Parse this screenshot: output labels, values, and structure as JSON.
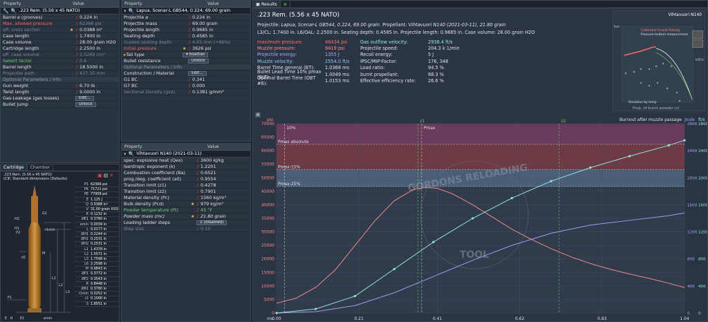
{
  "p1": {
    "col_property": "Property",
    "col_value": "Value",
    "title": ".223 Rem. (5.56 x 45 NATO)",
    "rows": [
      {
        "k": "Barrel ⌀ (grooves)",
        "v": "0.224 in",
        "kc": "",
        "vc": ""
      },
      {
        "k": "Max. allowed pressure",
        "v": "62366 psi",
        "kc": "red",
        "vc": "grey"
      },
      {
        "k": "eff. cross section",
        "v": "0.0388 in²",
        "kc": "grey",
        "vc": "",
        "star": true
      },
      {
        "k": "Case length",
        "v": "1.7400 in",
        "kc": "",
        "vc": ""
      },
      {
        "k": "Case volume",
        "v": "28.00 grain H2O",
        "kc": "",
        "vc": ""
      },
      {
        "k": "Cartridge length",
        "v": "2.2500 in",
        "kc": "",
        "vc": ""
      },
      {
        "k": "eff. case volume",
        "v": "1.5269 cm³",
        "kc": "grey",
        "vc": "grey"
      },
      {
        "k": "Sebert factor",
        "v": "0.6",
        "kc": "green",
        "vc": "grey"
      },
      {
        "k": "Barrel length",
        "v": "18.5000 in",
        "kc": "",
        "vc": ""
      },
      {
        "k": "Projectile path",
        "v": "437.35 mm",
        "kc": "grey",
        "vc": "grey"
      }
    ],
    "section": "Optional Parameters / Info",
    "rows2": [
      {
        "k": "Gun weight",
        "v": "6.70 lb"
      },
      {
        "k": "Twist length",
        "v": "9.0000 in"
      },
      {
        "k": "Gas-Leakage (gas losses)",
        "btn": "Edit..."
      },
      {
        "k": "Bullet Jump",
        "btn": "Unlock"
      }
    ]
  },
  "cart": {
    "tab1": "Cartridge",
    "tab2": "Chamber",
    "title1": ".223 Rem. (5.56 x 45 NATO)",
    "title2": "(CIP, Standard dimensions (Defaults)",
    "rows": [
      [
        "P1",
        "62366 psi"
      ],
      [
        "PK",
        "71721 psi"
      ],
      [
        "PE",
        "77958 psi"
      ],
      [
        "E",
        "1.125 J"
      ],
      [
        "Q",
        "0.0388 in²"
      ],
      [
        "V",
        "31.00 grain H2O"
      ],
      [
        "R",
        "0.1232 in"
      ],
      [
        "ØE1",
        "0.3780 in"
      ],
      [
        "emin",
        "0.0039 in"
      ],
      [
        "L",
        "0.0177 in"
      ],
      [
        "ØH1",
        "0.2244 in"
      ],
      [
        "ØH1",
        "0.2531 in"
      ],
      [
        "ØH2",
        "0.2531 in"
      ],
      [
        "L1",
        "1.4378 in"
      ],
      [
        "L2",
        "1.5571 in"
      ],
      [
        "L3",
        "1.7598 in"
      ],
      [
        "L6",
        "2.2598 in"
      ],
      [
        "M",
        "0.9843 in"
      ],
      [
        "ØP1",
        "0.3772 in"
      ],
      [
        "ØP2",
        "0.3543 in"
      ],
      [
        "R",
        "0.8448 in"
      ],
      [
        "ØR1",
        "0.3780 in"
      ],
      [
        "r1min",
        "0.0252 in"
      ],
      [
        "r2",
        "0.1000 in"
      ],
      [
        "S",
        "1.8551 in"
      ]
    ]
  },
  "p2": {
    "col_property": "Property",
    "col_value": "Value",
    "title": "Lapua, Scenar-L GB544, 0.224, 69.00 grain",
    "rows": [
      {
        "k": "Projectile ⌀",
        "v": "0.224 in"
      },
      {
        "k": "Projectile mass",
        "v": "69.00 grain"
      },
      {
        "k": "Projectile length",
        "v": "0.9685 in"
      },
      {
        "k": "Seating depth",
        "v": "0.4585 in"
      },
      {
        "k": "Guided seating depth",
        "v": "4.65 mm (+86%)",
        "kc": "grey",
        "vc": "grey"
      },
      {
        "k": "Initial pressure",
        "v": "3626 psi",
        "kc": "red",
        "star": true
      },
      {
        "k": "Bullet resistance",
        "btn": "Unlock"
      }
    ],
    "section": "Optional Parameters / Info",
    "rows2": [
      {
        "k": "Construction / Material",
        "btn": "Edit..."
      },
      {
        "k": "G1 BC",
        "v": "0.341"
      },
      {
        "k": "G7 BC",
        "v": "0.000"
      },
      {
        "k": "Sectional Density (gsd)",
        "v": "0.1381 g/mm²",
        "kc": "grey"
      }
    ],
    "tail_label": "Tail type",
    "tail_btn": "boattail"
  },
  "p3": {
    "col_property": "Property",
    "col_value": "Value",
    "title": "Vihtavuori N140 (2021-03-11)",
    "rows": [
      {
        "k": "spec. explosive heat (Qex)",
        "v": "3600 kJ/kg"
      },
      {
        "k": "Isentropic exponent (k)",
        "v": "1.2201"
      },
      {
        "k": "Combustion coefficient (Ba)",
        "v": "0.6521"
      },
      {
        "k": "prog./deg. coefficient (a0)",
        "v": "0.9554"
      },
      {
        "k": "Transition limit (z1)",
        "v": "0.4278"
      },
      {
        "k": "Transition limit (z2)",
        "v": "0.7901"
      },
      {
        "k": "Material density (Pc)",
        "v": "1560 kg/m³"
      },
      {
        "k": "Bulk density (Pcd)",
        "v": "979 kg/m³",
        "star": true
      },
      {
        "k": "Powder temperature (Pt)",
        "v": "45 °F",
        "kc": "green",
        "vc": "green"
      },
      {
        "k": "Powder mass (mc)",
        "v": "21.80 grain",
        "kc": "italic",
        "vc": "italic",
        "star": true
      },
      {
        "k": "Loading ladder steps",
        "btn": "1 (disabled)"
      },
      {
        "k": "Step size",
        "v": "0.10",
        "kc": "grey",
        "vc": "grey"
      }
    ]
  },
  "results": {
    "tab": "Results",
    "title": ".223 Rem. (5.56 x 45 NATO)",
    "line1_label": "Projectile:",
    "line1_val": "Lapua, Scenar-L GB544, 0.224, 69.00 grain",
    "line1_prop": "Propellant:",
    "line1_prop_val": "Vihtavuori N140 (2021-03-11), 21.80 grain",
    "line2": "L3/CL: 1.7400 in. L6/OAL: 2.2500 in. Seating depth: 0.4585 in. Projectile length: 0.9685 in. Case volume: 28.00 grain H2O",
    "left": [
      [
        "maximum pressure:",
        "46434 psi"
      ],
      [
        "Muzzle pressure:",
        "9419 psi"
      ],
      [
        "Projectile energy:",
        "1355 J"
      ],
      [
        "Muzzle velocity:",
        "2554.0 ft/s"
      ],
      [
        "Barrel Time general (BT):",
        "1.0368 ms"
      ],
      [
        "Bullet Lead Time 10% pmax (BLT):",
        "1.0049 ms"
      ],
      [
        "Optimal Barrel Time (OBT #6):",
        "1.0153 ms"
      ]
    ],
    "right": [
      [
        "Gas outflow velocity:",
        "2938.4 ft/s"
      ],
      [
        "Projectile speed:",
        "204.3 k 1/min"
      ],
      [
        "Recoil energy:",
        "5 J"
      ],
      [
        "IPSC/MIP-Factor:",
        "176, 348"
      ],
      [
        "Load ratio:",
        "94.5 %"
      ],
      [
        "burnt propellant:",
        "88.3 %"
      ],
      [
        "Effective efficiency rate:",
        "26.6 %"
      ]
    ]
  },
  "mini": {
    "title": "Vihtavuori N140",
    "lbl_bar": "bar",
    "lbl_kw": "kW/s",
    "legend1": "Calibrated Vivalat Ratio/g",
    "legend2": "Pressure bottom measurement",
    "legend3": "Deviation by temp",
    "x_title": "Prop. of burnt powder (z)",
    "x_ticks": [
      "0",
      "0.2",
      "0.4",
      "0.6",
      "0.8",
      "1"
    ]
  },
  "chart_data": {
    "type": "line",
    "x_unit": "ms",
    "y_left_unit": "psi",
    "y_right1_unit": "Joule",
    "y_right2_unit": "ft/s",
    "xlim": [
      0,
      1.04
    ],
    "ylim_left": [
      0,
      70000
    ],
    "ylim_right1": [
      0,
      2800
    ],
    "ylim_right2": [
      0,
      2800
    ],
    "x_ticks": [
      "0.00",
      "0.21",
      "0.41",
      "0.62",
      "0.83",
      "1.04"
    ],
    "y_left_ticks": [
      "0",
      "5000",
      "10000",
      "15000",
      "20000",
      "25000",
      "30000",
      "35000",
      "40000",
      "45000",
      "50000",
      "55000",
      "60000",
      "65000",
      "70000"
    ],
    "y_right1_ticks": [
      "0",
      "400",
      "800",
      "1200",
      "1600",
      "2000",
      "2400",
      "2800"
    ],
    "y_right2_ticks": [
      "0",
      "400",
      "800",
      "1200",
      "1600",
      "2000",
      "2400",
      "2800"
    ],
    "annotations": {
      "burnout": "Burnout after muzzle passage",
      "p10": "10%",
      "pmax": "Pmax",
      "z1": "z1",
      "z2": "z2",
      "p_abs": "Pmax absolute",
      "p15": "Pmax-15%",
      "p25": "Pmax-25%",
      "watermark1": "GORDONS RELOADING",
      "watermark2": "TOOL"
    },
    "series": [
      {
        "name": "Pressure",
        "color": "#f08a8a",
        "x": [
          0,
          0.05,
          0.1,
          0.15,
          0.2,
          0.25,
          0.3,
          0.35,
          0.38,
          0.41,
          0.45,
          0.5,
          0.55,
          0.6,
          0.65,
          0.7,
          0.75,
          0.8,
          0.85,
          0.9,
          0.95,
          1.0,
          1.04
        ],
        "y": [
          3626,
          5500,
          9500,
          16000,
          25000,
          34000,
          41500,
          45800,
          46434,
          46100,
          44000,
          40000,
          35500,
          31000,
          27200,
          23800,
          20800,
          18300,
          16200,
          14400,
          12800,
          11000,
          9419
        ]
      },
      {
        "name": "Energy",
        "color": "#9e9ef3",
        "x": [
          0,
          0.1,
          0.2,
          0.3,
          0.4,
          0.5,
          0.6,
          0.7,
          0.8,
          0.9,
          1.0,
          1.04
        ],
        "y": [
          0,
          20,
          110,
          300,
          540,
          780,
          1000,
          1180,
          1300,
          1370,
          1440,
          1480
        ]
      },
      {
        "name": "Velocity",
        "color": "#8fe8e0",
        "x": [
          0,
          0.1,
          0.2,
          0.3,
          0.4,
          0.5,
          0.6,
          0.7,
          0.8,
          0.9,
          1.0,
          1.04
        ],
        "y": [
          0,
          60,
          250,
          650,
          1050,
          1400,
          1700,
          1950,
          2150,
          2320,
          2480,
          2554
        ]
      }
    ]
  }
}
